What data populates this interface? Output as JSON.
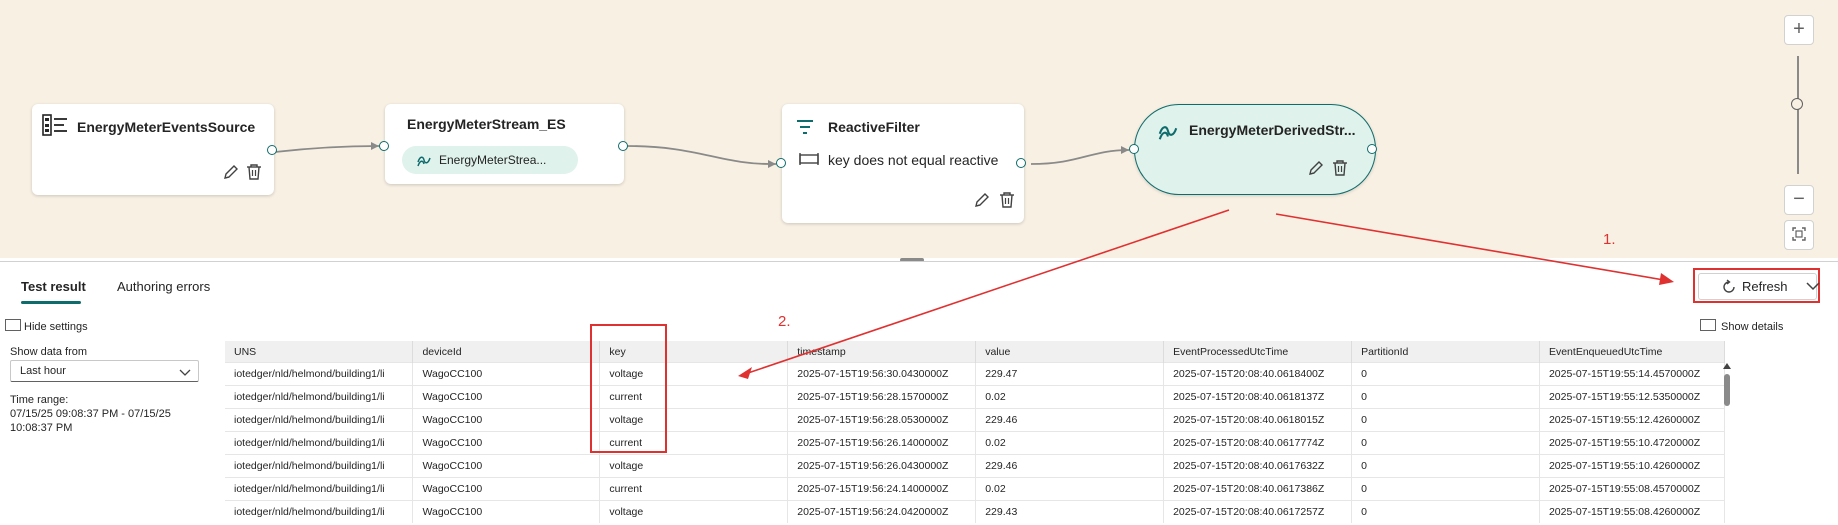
{
  "canvas": {
    "nodes": {
      "source": {
        "title": "EnergyMeterEventsSource"
      },
      "stream": {
        "title": "EnergyMeterStream_ES",
        "chip": "EnergyMeterStrea..."
      },
      "filter": {
        "title": "ReactiveFilter",
        "condition": "key does not equal reactive"
      },
      "derived": {
        "title": "EnergyMeterDerivedStr..."
      }
    },
    "zoom": {
      "in_label": "+",
      "out_label": "−"
    }
  },
  "panel": {
    "tabs": [
      {
        "label": "Test result",
        "active": true
      },
      {
        "label": "Authoring errors",
        "active": false
      }
    ],
    "refresh_label": "Refresh",
    "hide_settings_label": "Hide settings",
    "show_details_label": "Show details",
    "show_data_from_label": "Show data from",
    "show_data_from_value": "Last hour",
    "time_range_label": "Time range:",
    "time_range_value_1": "07/15/25 09:08:37 PM - 07/15/25",
    "time_range_value_2": "10:08:37 PM"
  },
  "table": {
    "columns": [
      "UNS",
      "deviceId",
      "key",
      "timestamp",
      "value",
      "EventProcessedUtcTime",
      "PartitionId",
      "EventEnqueuedUtcTime"
    ],
    "rows": [
      [
        "iotedger/nld/helmond/building1/li",
        "WagoCC100",
        "voltage",
        "2025-07-15T19:56:30.0430000Z",
        "229.47",
        "2025-07-15T20:08:40.0618400Z",
        "0",
        "2025-07-15T19:55:14.4570000Z"
      ],
      [
        "iotedger/nld/helmond/building1/li",
        "WagoCC100",
        "current",
        "2025-07-15T19:56:28.1570000Z",
        "0.02",
        "2025-07-15T20:08:40.0618137Z",
        "0",
        "2025-07-15T19:55:12.5350000Z"
      ],
      [
        "iotedger/nld/helmond/building1/li",
        "WagoCC100",
        "voltage",
        "2025-07-15T19:56:28.0530000Z",
        "229.46",
        "2025-07-15T20:08:40.0618015Z",
        "0",
        "2025-07-15T19:55:12.4260000Z"
      ],
      [
        "iotedger/nld/helmond/building1/li",
        "WagoCC100",
        "current",
        "2025-07-15T19:56:26.1400000Z",
        "0.02",
        "2025-07-15T20:08:40.0617774Z",
        "0",
        "2025-07-15T19:55:10.4720000Z"
      ],
      [
        "iotedger/nld/helmond/building1/li",
        "WagoCC100",
        "voltage",
        "2025-07-15T19:56:26.0430000Z",
        "229.46",
        "2025-07-15T20:08:40.0617632Z",
        "0",
        "2025-07-15T19:55:10.4260000Z"
      ],
      [
        "iotedger/nld/helmond/building1/li",
        "WagoCC100",
        "current",
        "2025-07-15T19:56:24.1400000Z",
        "0.02",
        "2025-07-15T20:08:40.0617386Z",
        "0",
        "2025-07-15T19:55:08.4570000Z"
      ],
      [
        "iotedger/nld/helmond/building1/li",
        "WagoCC100",
        "voltage",
        "2025-07-15T19:56:24.0420000Z",
        "229.43",
        "2025-07-15T20:08:40.0617257Z",
        "0",
        "2025-07-15T19:55:08.4260000Z"
      ]
    ]
  },
  "annotations": {
    "step1": "1.",
    "step2": "2."
  },
  "colors": {
    "accent": "#0f6c6c",
    "annotation_red": "#e03131",
    "canvas_bg": "#f8f0e3",
    "derived_fill": "#dff2ec"
  }
}
